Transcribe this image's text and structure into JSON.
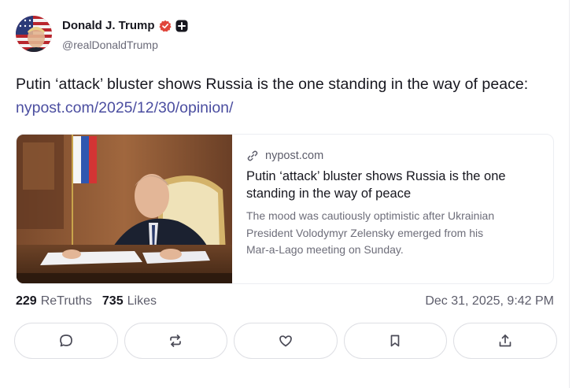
{
  "author": {
    "display_name": "Donald J. Trump",
    "handle": "@realDonaldTrump",
    "avatar_icon": "flag-portrait-avatar",
    "verified_icon": "verified-badge-icon",
    "verified_color": "#e0453a",
    "plus_icon": "plus-badge-icon"
  },
  "post": {
    "text": "Putin ‘attack’ bluster shows Russia is the one standing in the way of peace:",
    "link": "nypost.com/2025/12/30/opinion/",
    "link_color": "#4b4ea0"
  },
  "preview": {
    "domain": "nypost.com",
    "domain_icon": "link-icon",
    "title": "Putin ‘attack’ bluster shows Russia is the one standing in the way of peace",
    "description": "The mood was cautiously optimistic after Ukrainian President Volodymyr Zelensky emerged from his Mar-a-Lago meeting on Sunday.",
    "image_icon": "article-photo"
  },
  "stats": {
    "retruths_count": "229",
    "retruths_label": "ReTruths",
    "likes_count": "735",
    "likes_label": "Likes",
    "timestamp": "Dec 31, 2025, 9:42 PM"
  },
  "actions": [
    {
      "name": "reply",
      "icon": "comment-icon"
    },
    {
      "name": "retruth",
      "icon": "repost-icon"
    },
    {
      "name": "like",
      "icon": "heart-icon"
    },
    {
      "name": "bookmark",
      "icon": "bookmark-icon"
    },
    {
      "name": "share",
      "icon": "share-icon"
    }
  ]
}
